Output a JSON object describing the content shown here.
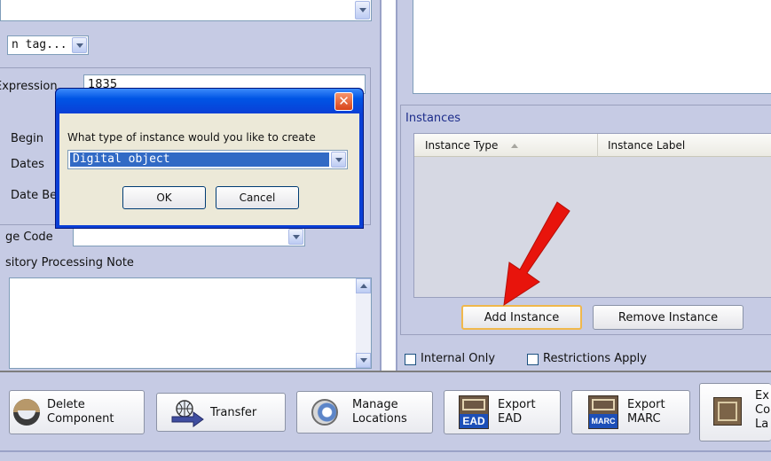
{
  "left_panel": {
    "tag_select_value": "n tag...",
    "expression_label": "Expression",
    "expression_value": "1835",
    "begin_label": "Begin",
    "dates_label": "Dates",
    "date_be_label": "Date Be",
    "language_code_label": "ge Code",
    "processing_note_label": "sitory Processing Note"
  },
  "dialog": {
    "prompt": "What type of instance would you like to create",
    "selected_option": "Digital object",
    "ok_label": "OK",
    "cancel_label": "Cancel"
  },
  "instances": {
    "section_title": "Instances",
    "columns": [
      "Instance Type",
      "Instance Label"
    ],
    "sort_indicator": "ascending",
    "add_label": "Add Instance",
    "remove_label": "Remove Instance"
  },
  "options": {
    "internal_only_label": "Internal Only",
    "restrictions_label": "Restrictions Apply"
  },
  "toolbar": {
    "delete_component": "Delete\nComponent",
    "transfer": "Transfer",
    "manage_locations": "Manage\nLocations",
    "export_ead": "Export\nEAD",
    "export_ead_badge": "EAD",
    "export_marc": "Export\nMARC",
    "export_marc_badge": "MARC",
    "export_container_labels": "Ex\nCo\nLa"
  },
  "colors": {
    "panel": "#c6cbe4",
    "selection": "#316ac5",
    "arrow": "#e8140c",
    "dialog_frame": "#0a3fd6"
  }
}
